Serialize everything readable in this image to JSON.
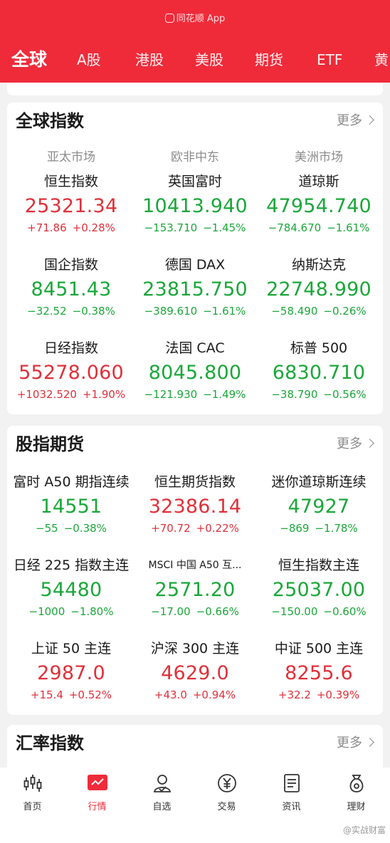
{
  "app_badge": "同花顺 App",
  "tabs": [
    "全球",
    "A股",
    "港股",
    "美股",
    "期货",
    "ETF",
    "黄"
  ],
  "more_label": "更多",
  "global_index": {
    "title": "全球指数",
    "regions": [
      "亚太市场",
      "欧非中东",
      "美洲市场"
    ],
    "items": [
      {
        "name": "恒生指数",
        "price": "25321.34",
        "change": "+71.86",
        "pct": "+0.28%",
        "dir": "up"
      },
      {
        "name": "英国富时",
        "price": "10413.940",
        "change": "−153.710",
        "pct": "−1.45%",
        "dir": "down"
      },
      {
        "name": "道琼斯",
        "price": "47954.740",
        "change": "−784.670",
        "pct": "−1.61%",
        "dir": "down"
      },
      {
        "name": "国企指数",
        "price": "8451.43",
        "change": "−32.52",
        "pct": "−0.38%",
        "dir": "down"
      },
      {
        "name": "德国 DAX",
        "price": "23815.750",
        "change": "−389.610",
        "pct": "−1.61%",
        "dir": "down"
      },
      {
        "name": "纳斯达克",
        "price": "22748.990",
        "change": "−58.490",
        "pct": "−0.26%",
        "dir": "down"
      },
      {
        "name": "日经指数",
        "price": "55278.060",
        "change": "+1032.520",
        "pct": "+1.90%",
        "dir": "up"
      },
      {
        "name": "法国 CAC",
        "price": "8045.800",
        "change": "−121.930",
        "pct": "−1.49%",
        "dir": "down"
      },
      {
        "name": "标普 500",
        "price": "6830.710",
        "change": "−38.790",
        "pct": "−0.56%",
        "dir": "down"
      }
    ]
  },
  "futures": {
    "title": "股指期货",
    "items": [
      {
        "name": "富时 A50 期指连续",
        "price": "14551",
        "change": "−55",
        "pct": "−0.38%",
        "dir": "down"
      },
      {
        "name": "恒生期货指数",
        "price": "32386.14",
        "change": "+70.72",
        "pct": "+0.22%",
        "dir": "up"
      },
      {
        "name": "迷你道琼斯连续",
        "price": "47927",
        "change": "−869",
        "pct": "−1.78%",
        "dir": "down"
      },
      {
        "name": "日经 225 指数主连",
        "price": "54480",
        "change": "−1000",
        "pct": "−1.80%",
        "dir": "down"
      },
      {
        "name": "MSCI 中国 A50 互...",
        "price": "2571.20",
        "change": "−17.00",
        "pct": "−0.66%",
        "dir": "down"
      },
      {
        "name": "恒生指数主连",
        "price": "25037.00",
        "change": "−150.00",
        "pct": "−0.60%",
        "dir": "down"
      },
      {
        "name": "上证 50 主连",
        "price": "2987.0",
        "change": "+15.4",
        "pct": "+0.52%",
        "dir": "up"
      },
      {
        "name": "沪深 300 主连",
        "price": "4629.0",
        "change": "+43.0",
        "pct": "+0.94%",
        "dir": "up"
      },
      {
        "name": "中证 500 主连",
        "price": "8255.6",
        "change": "+32.2",
        "pct": "+0.39%",
        "dir": "up"
      }
    ]
  },
  "fx": {
    "title": "汇率指数"
  },
  "nav": [
    {
      "label": "首页",
      "icon": "candlestick-icon"
    },
    {
      "label": "行情",
      "icon": "market-chart-icon"
    },
    {
      "label": "自选",
      "icon": "user-check-icon"
    },
    {
      "label": "交易",
      "icon": "yen-coin-icon"
    },
    {
      "label": "资讯",
      "icon": "news-doc-icon"
    },
    {
      "label": "理财",
      "icon": "money-bag-icon"
    }
  ],
  "watermark": "@实战财富",
  "colors": {
    "brand": "#ef2b3a",
    "up": "#e0303a",
    "down": "#1ba73a"
  }
}
